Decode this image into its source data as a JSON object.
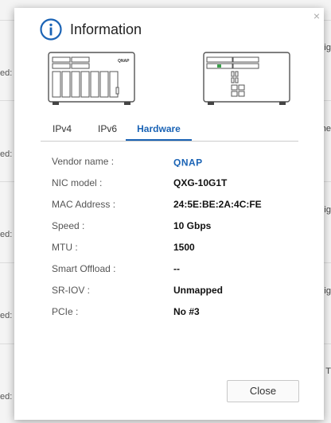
{
  "background": {
    "labels": [
      "ed:",
      "ed:",
      "ed:",
      "ed:",
      "ed:"
    ],
    "right_fragments": [
      "Sig",
      "he",
      "Sig",
      "Sig",
      "T"
    ]
  },
  "dialog": {
    "title": "Information",
    "close_glyph": "×",
    "tabs": [
      "IPv4",
      "IPv6",
      "Hardware"
    ],
    "active_tab": "Hardware",
    "vendor_logo_text": "QNAP",
    "rows": [
      {
        "label": "Vendor name :",
        "value": ""
      },
      {
        "label": "NIC model :",
        "value": "QXG-10G1T"
      },
      {
        "label": "MAC Address :",
        "value": "24:5E:BE:2A:4C:FE"
      },
      {
        "label": "Speed :",
        "value": "10 Gbps"
      },
      {
        "label": "MTU :",
        "value": "1500"
      },
      {
        "label": "Smart Offload :",
        "value": "--"
      },
      {
        "label": "SR-IOV :",
        "value": "Unmapped"
      },
      {
        "label": "PCIe :",
        "value": "No #3"
      }
    ],
    "close_label": "Close",
    "accent_color": "#1a63b5",
    "icon": "info-icon"
  }
}
